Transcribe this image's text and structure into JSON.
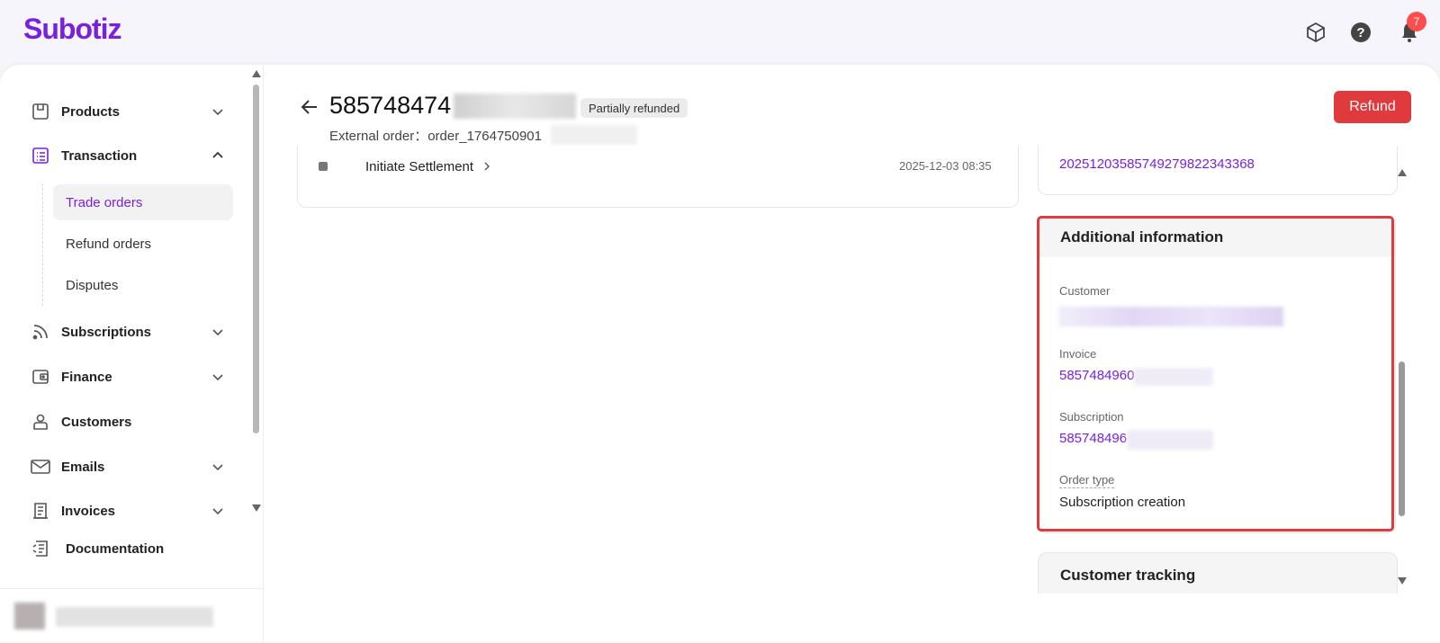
{
  "app": {
    "brand": "Subotiz"
  },
  "topbar": {
    "icons": [
      "package-icon",
      "help-icon",
      "bell-icon"
    ],
    "notification_count": "7"
  },
  "sidebar": {
    "items": [
      {
        "label": "Products",
        "icon": "products-icon"
      },
      {
        "label": "Transaction",
        "icon": "transaction-icon"
      },
      {
        "label": "Subscriptions",
        "icon": "subscriptions-icon"
      },
      {
        "label": "Finance",
        "icon": "finance-icon"
      },
      {
        "label": "Customers",
        "icon": "customers-icon"
      },
      {
        "label": "Emails",
        "icon": "emails-icon"
      },
      {
        "label": "Invoices",
        "icon": "invoices-icon"
      },
      {
        "label": "Documentation",
        "icon": "documentation-icon"
      }
    ],
    "transaction_sub": [
      "Trade orders",
      "Refund orders",
      "Disputes"
    ]
  },
  "header": {
    "order_id": "585748474",
    "status": "Partially refunded",
    "external_order": "External order：order_1764750901",
    "refund_label": "Refund"
  },
  "timeline": {
    "event": "Initiate Settlement",
    "time": "2025-12-03 08:35"
  },
  "right_top": {
    "partial_id": "20251203585749279822343368"
  },
  "additional_info": {
    "title": "Additional information",
    "customer_label": "Customer",
    "invoice_label": "Invoice",
    "invoice_value": "5857484960",
    "subscription_label": "Subscription",
    "subscription_value": "585748496",
    "order_type_label": "Order type",
    "order_type_value": "Subscription creation"
  },
  "customer_tracking": {
    "title": "Customer tracking"
  },
  "colors": {
    "brand": "#7a1fe0",
    "danger": "#e03a3e",
    "highlight": "#e03a3e"
  }
}
